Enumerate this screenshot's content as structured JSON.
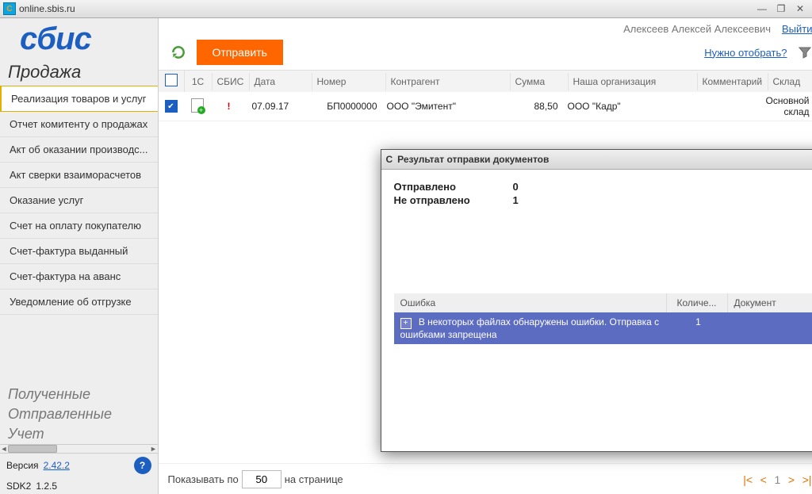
{
  "window": {
    "title": "online.sbis.ru"
  },
  "logo": "сбис",
  "sidebar_title": "Продажа",
  "menu": [
    "Реализация товаров и услуг",
    "Отчет комитенту о продажах",
    "Акт об оказании производс...",
    "Акт сверки взаиморасчетов",
    "Оказание услуг",
    "Счет на оплату покупателю",
    "Счет-фактура выданный",
    "Счет-фактура на аванс",
    "Уведомление об отгрузке"
  ],
  "side_sections": [
    "Полученные",
    "Отправленные",
    "Учет"
  ],
  "version": {
    "label": "Версия",
    "value": "2.42.2",
    "sdk_label": "SDK2",
    "sdk_value": "1.2.5"
  },
  "user": {
    "name": "Алексеев Алексей Алексеевич",
    "logout": "Выйти"
  },
  "toolbar": {
    "send": "Отправить",
    "filter_hint": "Нужно отобрать?"
  },
  "columns": {
    "c1": "1С",
    "c2": "СБИС",
    "c3": "Дата",
    "c4": "Номер",
    "c5": "Контрагент",
    "c6": "Сумма",
    "c7": "Наша организация",
    "c8": "Комментарий",
    "c9": "Склад"
  },
  "row": {
    "date": "07.09.17",
    "num": "БП0000000",
    "contr": "ООО \"Эмитент\"",
    "sum": "88,50",
    "org": "ООО \"Кадр\"",
    "wh": "Основной склад"
  },
  "modal": {
    "title": "Результат отправки документов",
    "sent_label": "Отправлено",
    "sent_value": "0",
    "unsent_label": "Не отправлено",
    "unsent_value": "1",
    "cols": {
      "err": "Ошибка",
      "cnt": "Количе...",
      "doc": "Документ"
    },
    "err_row": {
      "text": "В некоторых файлах обнаружены ошибки. Отправка с ошибками запрещена",
      "cnt": "1"
    }
  },
  "footer": {
    "show": "Показывать по",
    "per": "50",
    "on_page": "на странице",
    "page": "1"
  }
}
